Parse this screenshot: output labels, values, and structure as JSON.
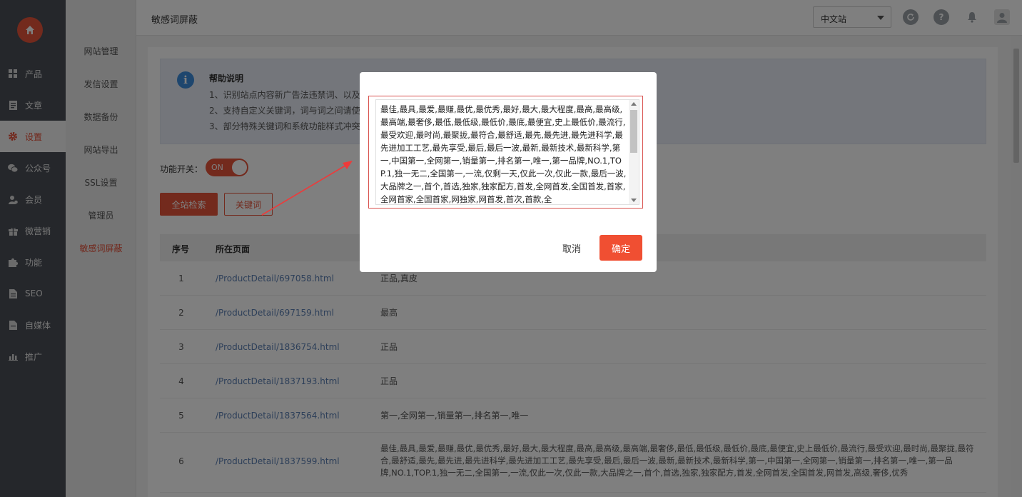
{
  "sidebar": {
    "logo": "home-icon",
    "items": [
      {
        "label": "产品",
        "icon": "grid-icon"
      },
      {
        "label": "文章",
        "icon": "document-icon"
      },
      {
        "label": "设置",
        "icon": "gear-icon",
        "active": true
      },
      {
        "label": "公众号",
        "icon": "wechat-icon"
      },
      {
        "label": "会员",
        "icon": "user-icon"
      },
      {
        "label": "微营销",
        "icon": "gift-icon"
      },
      {
        "label": "功能",
        "icon": "puzzle-icon"
      },
      {
        "label": "SEO",
        "icon": "page-icon"
      },
      {
        "label": "自媒体",
        "icon": "media-icon"
      },
      {
        "label": "推广",
        "icon": "chart-icon"
      }
    ]
  },
  "submenu": {
    "items": [
      "网站管理",
      "发信设置",
      "数据备份",
      "网站导出",
      "SSL设置",
      "管理员",
      "敏感词屏蔽"
    ],
    "active": "敏感词屏蔽"
  },
  "header": {
    "title": "敏感词屏蔽",
    "site_select": "中文站",
    "icons": [
      "refresh-icon",
      "help-icon",
      "bell-icon",
      "user-avatar-icon"
    ]
  },
  "help": {
    "title": "帮助说明",
    "lines": [
      "1、识别站点内容新广告法违禁词、以及",
      "2、支持自定义关键词，词与词之间请使",
      "3、部分特殊关键词和系统功能样式冲突"
    ]
  },
  "feature_switch": {
    "label": "功能开关：",
    "state": "ON"
  },
  "buttons": {
    "scan": "全站检索",
    "keywords": "关键词"
  },
  "table": {
    "headers": [
      "序号",
      "所在页面"
    ],
    "rows": [
      {
        "no": "1",
        "page": "/ProductDetail/697058.html",
        "words": "正品,真皮"
      },
      {
        "no": "2",
        "page": "/ProductDetail/697159.html",
        "words": "最高"
      },
      {
        "no": "3",
        "page": "/ProductDetail/1836754.html",
        "words": "正品"
      },
      {
        "no": "4",
        "page": "/ProductDetail/1837193.html",
        "words": "正品"
      },
      {
        "no": "5",
        "page": "/ProductDetail/1837564.html",
        "words": "第一,全网第一,销量第一,排名第一,唯一"
      },
      {
        "no": "6",
        "page": "/ProductDetail/1837599.html",
        "words": "最佳,最具,最爱,最赚,最优,最优秀,最好,最大,最大程度,最高,最高级,最高端,最奢侈,最低,最低级,最低价,最底,最便宜,史上最低价,最流行,最受欢迎,最时尚,最聚拢,最符合,最舒适,最先,最先进,最先进科学,最先进加工工艺,最先享受,最后,最后一波,最新,最新技术,最新科学,第一,中国第一,全网第一,销量第一,排名第一,唯一,第一品牌,NO.1,TOP.1,独一无二,全国第一,一流,仅此一次,仅此一款,大品牌之一,首个,首选,独家,独家配方,首发,全网首发,全国首发,网首发,高级,奢侈,优秀"
      }
    ]
  },
  "modal": {
    "textarea_value": "最佳,最具,最爱,最赚,最优,最优秀,最好,最大,最大程度,最高,最高级,最高端,最奢侈,最低,最低级,最低价,最底,最便宜,史上最低价,最流行,最受欢迎,最时尚,最聚拢,最符合,最舒适,最先,最先进,最先进科学,最先进加工工艺,最先享受,最后,最后一波,最新,最新技术,最新科学,第一,中国第一,全网第一,销量第一,排名第一,唯一,第一品牌,NO.1,TOP.1,独一无二,全国第一,一流,仅剩一天,仅此一次,仅此一款,最后一波,大品牌之一,首个,首选,独家,独家配方,首发,全网首发,全国首发,首家,全网首家,全国首家,网独家,网首发,首次,首款,全",
    "cancel": "取消",
    "confirm": "确定"
  },
  "colors": {
    "accent": "#e7543a",
    "sidebar": "#4b4e56",
    "link": "#5b7fb2"
  }
}
